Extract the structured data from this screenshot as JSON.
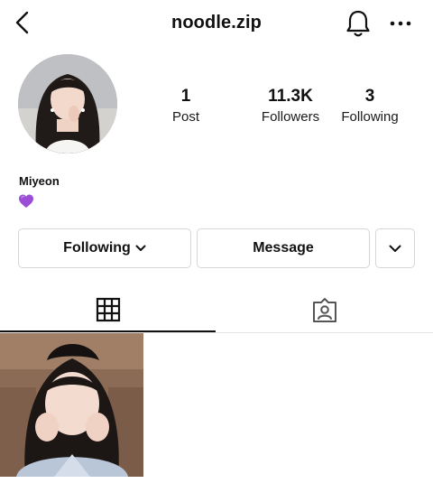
{
  "header": {
    "username": "noodle.zip",
    "icons": [
      "back-chevron-icon",
      "bell-icon",
      "more-dots-icon"
    ]
  },
  "profile": {
    "posts_count": "1",
    "posts_label": "Post",
    "followers_count": "11.3K",
    "followers_label": "Followers",
    "following_count": "3",
    "following_label": "Following"
  },
  "bio": {
    "name": "Miyeon",
    "emoji_icon": "purple-heart-icon"
  },
  "actions": {
    "following_label": "Following",
    "message_label": "Message"
  },
  "tabs": [
    {
      "name": "posts-grid",
      "icon": "grid-icon"
    },
    {
      "name": "tagged",
      "icon": "tagged-person-icon"
    }
  ],
  "colors": {
    "text": "#111111",
    "border": "#d6d6d6",
    "heart": "#9b4dd6"
  }
}
